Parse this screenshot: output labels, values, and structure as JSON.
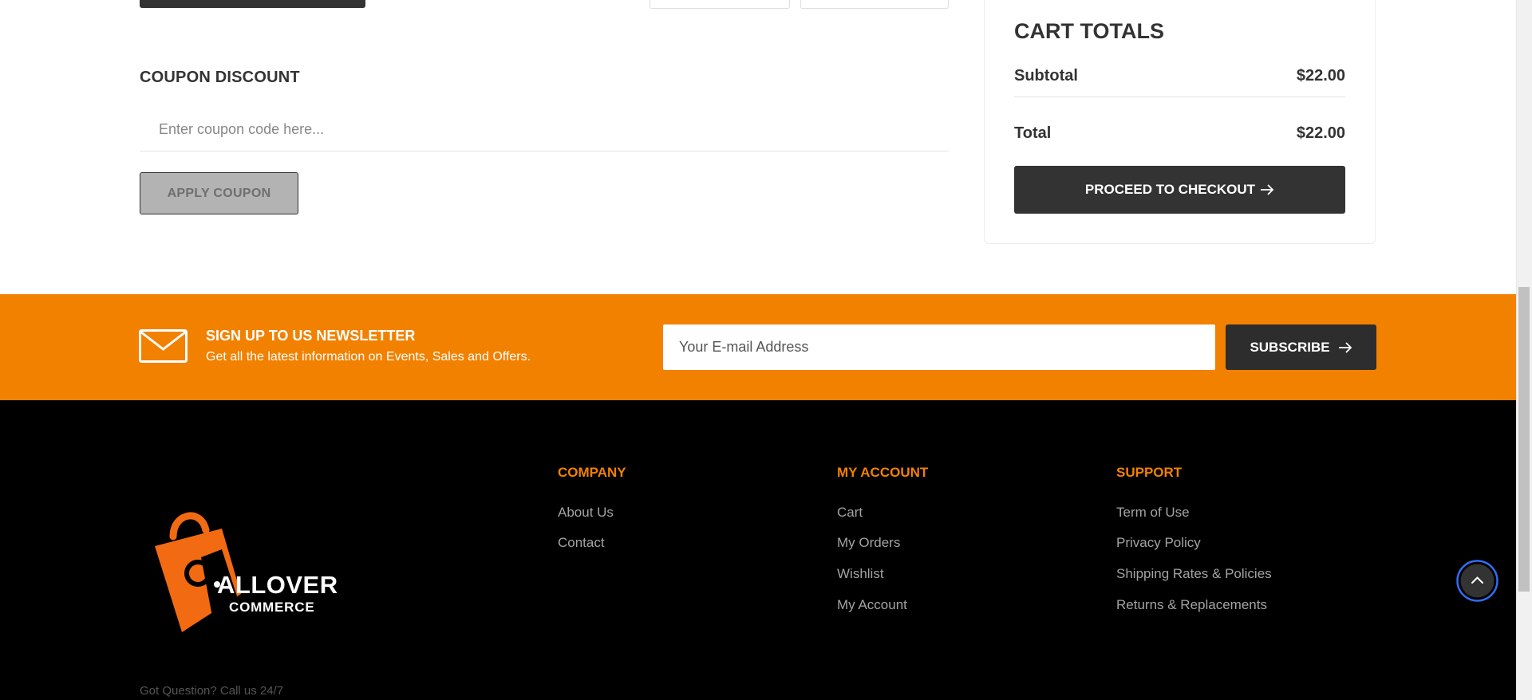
{
  "coupon": {
    "title": "COUPON DISCOUNT",
    "placeholder": "Enter coupon code here...",
    "apply_label": "APPLY COUPON"
  },
  "cart_totals": {
    "title": "CART TOTALS",
    "subtotal_label": "Subtotal",
    "subtotal_value": "$22.00",
    "total_label": "Total",
    "total_value": "$22.00",
    "checkout_label": "PROCEED TO CHECKOUT",
    "checkout_icon": "arrow-right-icon"
  },
  "newsletter": {
    "icon": "envelope-icon",
    "title": "SIGN UP TO US NEWSLETTER",
    "subtitle": "Get all the latest information on Events, Sales and Offers.",
    "placeholder": "Your E-mail Address",
    "subscribe_label": "SUBSCRIBE",
    "subscribe_icon": "arrow-right-icon"
  },
  "footer": {
    "logo_line1": "ALLOVER",
    "logo_line2": "COMMERCE",
    "got_question": "Got Question? Call us 24/7",
    "columns": [
      {
        "title": "COMPANY",
        "links": [
          "About Us",
          "Contact"
        ]
      },
      {
        "title": "MY ACCOUNT",
        "links": [
          "Cart",
          "My Orders",
          "Wishlist",
          "My Account"
        ]
      },
      {
        "title": "SUPPORT",
        "links": [
          "Term of Use",
          "Privacy Policy",
          "Shipping Rates & Policies",
          "Returns & Replacements"
        ]
      }
    ]
  },
  "back_to_top": {
    "icon": "chevron-up-icon"
  },
  "colors": {
    "accent": "#f28100",
    "dark": "#333333",
    "footer_bg": "#000000",
    "link": "#a3a3a3",
    "progress_ring": "#2f6df6"
  }
}
